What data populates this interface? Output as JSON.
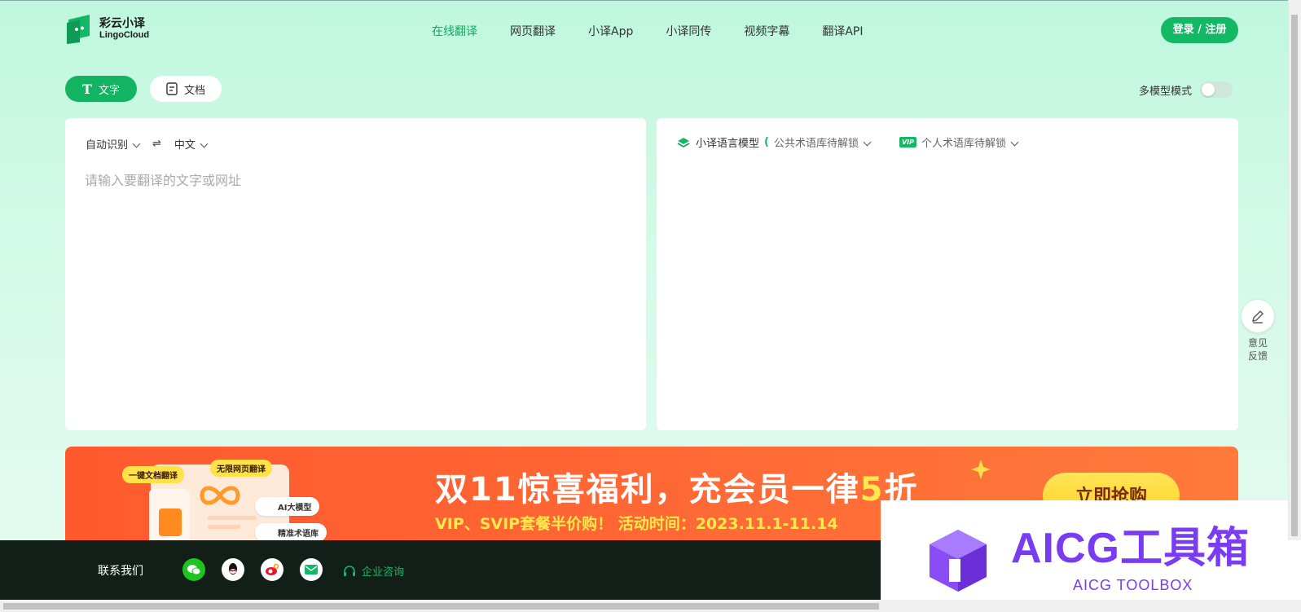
{
  "logo": {
    "cn": "彩云小译",
    "en": "LingoCloud"
  },
  "nav": [
    {
      "label": "在线翻译",
      "active": true
    },
    {
      "label": "网页翻译",
      "active": false
    },
    {
      "label": "小译App",
      "active": false
    },
    {
      "label": "小译同传",
      "active": false
    },
    {
      "label": "视频字幕",
      "active": false
    },
    {
      "label": "翻译API",
      "active": false
    }
  ],
  "login_label": "登录 / 注册",
  "tabs": {
    "text": "文字",
    "doc": "文档"
  },
  "multi_model": {
    "label": "多模型模式",
    "enabled": false
  },
  "source": {
    "lang_from": "自动识别",
    "swap": "⇌",
    "lang_to": "中文",
    "placeholder": "请输入要翻译的文字或网址"
  },
  "target": {
    "model": "小译语言模型",
    "paren": "(",
    "public_term": "公共术语库待解锁",
    "vip": "VIP",
    "personal_term": "个人术语库待解锁"
  },
  "feedback": {
    "label": "意见反馈"
  },
  "banner": {
    "title_prefix": "双11惊喜福利，充会员一律",
    "title_num": "5",
    "title_suffix": "折",
    "subtitle": "VIP、SVIP套餐半价购！ 活动时间：2023.11.1-11.14",
    "button": "立即抢购",
    "pill_doc": "一键文档翻译",
    "pill_web": "无限网页翻译",
    "chip_ai": "AI大模型",
    "chip_term": "精准术语库"
  },
  "footer": {
    "contact": "联系我们",
    "consult": "企业咨询"
  },
  "watermark": {
    "title": "AICG工具箱",
    "sub": "AICG TOOLBOX"
  },
  "colors": {
    "accent": "#13b865",
    "banner": "#ff5a2e",
    "footer": "#121f19",
    "watermark": "#7a3cf0"
  }
}
